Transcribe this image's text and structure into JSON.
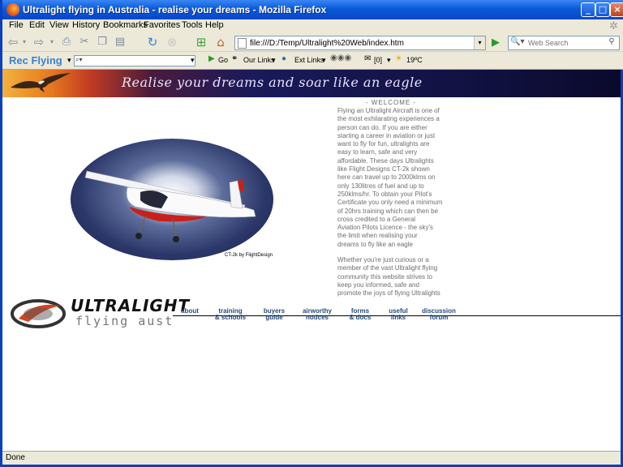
{
  "window": {
    "title": "Ultralight flying in Australia - realise your dreams - Mozilla Firefox"
  },
  "menu": [
    "File",
    "Edit",
    "View",
    "History",
    "Bookmarks",
    "Favorites",
    "Tools",
    "Help"
  ],
  "address": {
    "url": "file:///D:/Temp/Ultralight%20Web/index.htm"
  },
  "search": {
    "placeholder": "Web Search"
  },
  "toolbar2": {
    "brand": "Rec Flying",
    "go_label": "Go",
    "our_links": "Our Links",
    "ext_links": "Ext Links",
    "mail_count": "[0]",
    "temperature": "19ºC"
  },
  "banner": {
    "slogan": "Realise your dreams and soar like an eagle"
  },
  "photo": {
    "caption": "CT-2k by FlightDesign"
  },
  "welcome": {
    "title": "- WELCOME -",
    "paragraph1_lines": [
      "Flying an Ultralight Aircraft is one of",
      "the most exhilarating experiences a",
      "person can do. If you are either",
      "starting a career in aviation or just",
      "want to fly for fun, ultralights are",
      "easy to learn, safe and very",
      "affordable. These days Ultralights",
      "like Flight Designs CT-2k shown",
      "here can travel up to 2000klms on",
      "only 130litres of fuel and up to",
      "250klms/hr. To obtain your Pilot's",
      "Certificate you only need a minimum",
      "of 20hrs training which can then be",
      "cross credited to a General",
      "Aviation Pilots Licence - the sky's",
      "the limit when realising your",
      "dreams to fly like an eagle"
    ],
    "paragraph2_lines": [
      "Whether you're just curious or a",
      "member of the vast Ultralight flying",
      "community this website strives to",
      "keep you informed, safe and",
      "promote the joys of flying Ultralights"
    ]
  },
  "logo": {
    "line1": "ULTRALIGHT",
    "line2": "flying aust"
  },
  "nav": [
    {
      "line1": "about",
      "line2": ""
    },
    {
      "line1": "training",
      "line2": "& schools"
    },
    {
      "line1": "buyers",
      "line2": "guide"
    },
    {
      "line1": "airworthy",
      "line2": "notices"
    },
    {
      "line1": "forms",
      "line2": "& docs"
    },
    {
      "line1": "useful",
      "line2": "links"
    },
    {
      "line1": "discussion",
      "line2": "forum"
    }
  ],
  "status": {
    "text": "Done"
  },
  "colors": {
    "titlebar": "#0a5ad9",
    "nav_link": "#264c80",
    "body_text": "#6e6e6e",
    "brand": "#3b7fd1"
  }
}
